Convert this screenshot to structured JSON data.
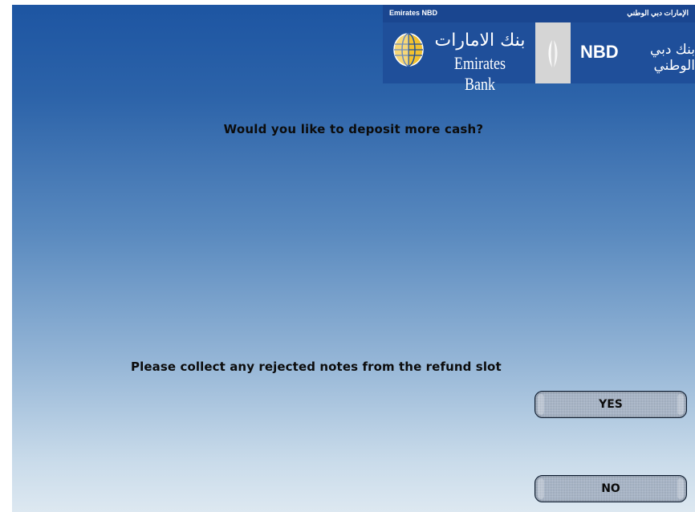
{
  "header": {
    "left_caption": "Emirates NBD",
    "right_caption": "الإمارات دبي الوطني",
    "emirates_bank_arabic": "بنك الامارات",
    "emirates_bank_english": "Emirates Bank",
    "nbd_english": "NBD",
    "nbd_arabic": "بنك دبي الوطني"
  },
  "main": {
    "question": "Would you like to deposit more cash?",
    "instruction": "Please collect any rejected notes from the refund slot"
  },
  "buttons": {
    "yes_label": "YES",
    "no_label": "NO"
  },
  "colors": {
    "brand_blue": "#1f4f9a",
    "background_top": "#1d55a2",
    "background_bottom": "#dde8f1",
    "button_fill": "#a7b5c8",
    "text": "#0c0c0c"
  },
  "icons": {
    "logo": "globe-icon",
    "divider_logo": "sail-icon"
  }
}
